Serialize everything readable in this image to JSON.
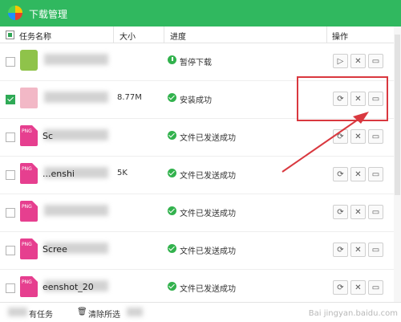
{
  "window": {
    "title": "下载管理"
  },
  "header": {
    "col_name": "任务名称",
    "col_size": "大小",
    "col_progress": "进度",
    "col_action": "操作"
  },
  "rows": [
    {
      "name": "",
      "size": "",
      "status": "暂停下载",
      "status_type": "paused",
      "checked": false,
      "file_type": "android",
      "actions": [
        "play-icon",
        "close-icon",
        "folder-icon"
      ]
    },
    {
      "name": "",
      "size": "8.77M",
      "status": "安装成功",
      "status_type": "done",
      "checked": true,
      "file_type": "blank",
      "actions": [
        "retry-icon",
        "close-icon",
        "folder-icon"
      ]
    },
    {
      "name": "Sc",
      "size": "",
      "status": "文件已发送成功",
      "status_type": "done",
      "checked": false,
      "file_type": "png",
      "actions": [
        "retry-icon",
        "close-icon",
        "folder-icon"
      ]
    },
    {
      "name": "...enshi",
      "size": "5K",
      "status": "文件已发送成功",
      "status_type": "done",
      "checked": false,
      "file_type": "png",
      "actions": [
        "retry-icon",
        "close-icon",
        "folder-icon"
      ]
    },
    {
      "name": "",
      "size": "",
      "status": "文件已发送成功",
      "status_type": "done",
      "checked": false,
      "file_type": "png",
      "actions": [
        "retry-icon",
        "close-icon",
        "folder-icon"
      ]
    },
    {
      "name": "Scree",
      "size": "",
      "status": "文件已发送成功",
      "status_type": "done",
      "checked": false,
      "file_type": "png",
      "actions": [
        "retry-icon",
        "close-icon",
        "folder-icon"
      ]
    },
    {
      "name": "eenshot_20",
      "size": "",
      "status": "文件已发送成功",
      "status_type": "done",
      "checked": false,
      "file_type": "png",
      "actions": [
        "retry-icon",
        "close-icon",
        "folder-icon"
      ]
    }
  ],
  "footer": {
    "delete_all_tasks": "有任务",
    "clear_selected": "清除所选"
  },
  "watermark": "Bai jingyan.baidu.com",
  "colors": {
    "title_bar": "#30b85f",
    "annotation": "#d9383f"
  }
}
